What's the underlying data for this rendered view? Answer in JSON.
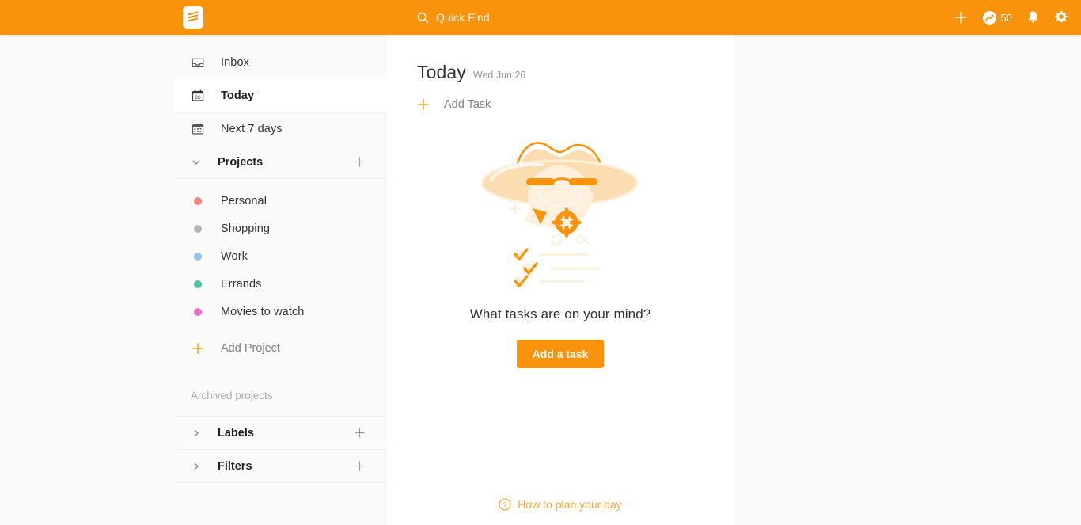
{
  "theme": {
    "brand_orange": "#f9930b",
    "sidebar_bg": "#fafafa",
    "content_bg": "#ffffff",
    "text": "#333333",
    "muted": "#999999"
  },
  "topbar": {
    "logo_name": "todoist-logo",
    "search": {
      "icon": "search-icon",
      "placeholder": "Quick Find",
      "label": "Quick Find"
    },
    "actions": {
      "add_label": "+",
      "add_icon": "plus-icon",
      "karma_icon": "productivity-icon",
      "karma_count": "50",
      "notifications_icon": "bell-icon",
      "settings_icon": "gear-icon"
    }
  },
  "sidebar": {
    "nav": [
      {
        "label": "Inbox",
        "icon": "inbox-icon",
        "selected": false
      },
      {
        "label": "Today",
        "icon": "calendar-today-icon",
        "day_number": "26",
        "selected": true
      },
      {
        "label": "Next 7 days",
        "icon": "calendar-week-icon",
        "selected": false
      }
    ],
    "projects_section": {
      "title": "Projects",
      "chevron": "chevron-down-icon",
      "add_icon": "plus-icon",
      "items": [
        {
          "name": "Personal",
          "color": "#ff8581"
        },
        {
          "name": "Shopping",
          "color": "#b8b8b8"
        },
        {
          "name": "Work",
          "color": "#96c3eb"
        },
        {
          "name": "Errands",
          "color": "#4cbfa6"
        },
        {
          "name": "Movies to watch",
          "color": "#e86ecb"
        }
      ],
      "add_project_label": "Add Project",
      "archived_label": "Archived projects"
    },
    "labels_section": {
      "title": "Labels",
      "chevron": "chevron-right-icon",
      "add_icon": "plus-icon"
    },
    "filters_section": {
      "title": "Filters",
      "chevron": "chevron-right-icon",
      "add_icon": "plus-icon"
    }
  },
  "main": {
    "title": "Today",
    "date": "Wed Jun 26",
    "add_task_label": "Add Task",
    "add_task_icon": "plus-icon",
    "empty_state": {
      "illustration": "summer-hat-checklist-illustration",
      "message": "What tasks are on your mind?",
      "button_label": "Add a task"
    },
    "help": {
      "icon": "question-circle-icon",
      "label": "How to plan your day"
    }
  }
}
